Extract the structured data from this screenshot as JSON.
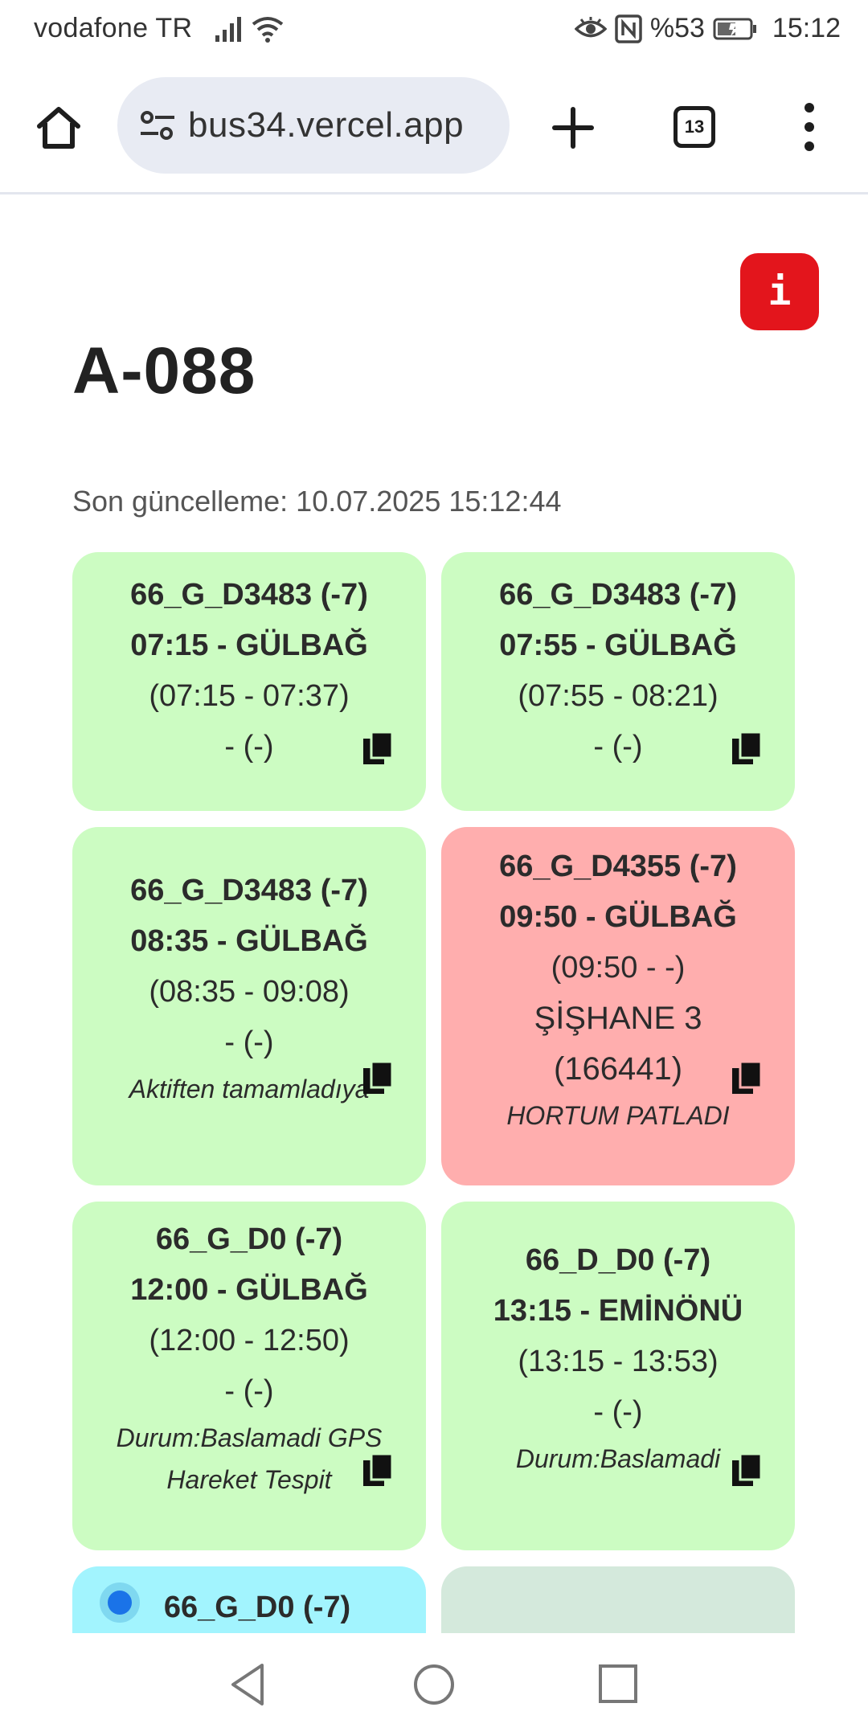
{
  "status_bar": {
    "carrier": "vodafone TR",
    "battery": "%53",
    "time": "15:12"
  },
  "browser": {
    "url": "bus34.vercel.app",
    "tab_count": "13"
  },
  "page": {
    "info_label": "i",
    "title": "A-088",
    "last_update": "Son güncelleme: 10.07.2025 15:12:44"
  },
  "cards": [
    {
      "status": "green",
      "code": "66_G_D3483 (-7)",
      "departure": "07:15 - GÜLBAĞ",
      "times": "(07:15 - 07:37)",
      "info": "- (-)"
    },
    {
      "status": "green",
      "code": "66_G_D3483 (-7)",
      "departure": "07:55 - GÜLBAĞ",
      "times": "(07:55 - 08:21)",
      "info": "- (-)"
    },
    {
      "status": "green",
      "code": "66_G_D3483 (-7)",
      "departure": "08:35 - GÜLBAĞ",
      "times": "(08:35 - 09:08)",
      "info": "- (-)",
      "note": "Aktiften tamamladıya"
    },
    {
      "status": "red",
      "code": "66_G_D4355 (-7)",
      "departure": "09:50 - GÜLBAĞ",
      "times": "(09:50 - -)",
      "driver": "ŞİŞHANE 3",
      "driver_id": "(166441)",
      "note": "HORTUM PATLADI"
    },
    {
      "status": "green",
      "code": "66_G_D0 (-7)",
      "departure": "12:00 - GÜLBAĞ",
      "times": "(12:00 - 12:50)",
      "info": "- (-)",
      "note_line1": "Durum:Baslamadi GPS",
      "note_line2": "Hareket Tespit"
    },
    {
      "status": "green",
      "code": "66_D_D0 (-7)",
      "departure": "13:15 - EMİNÖNÜ",
      "times": "(13:15 - 13:53)",
      "info": "- (-)",
      "note": "Durum:Baslamadi"
    },
    {
      "status": "cyan",
      "code": "66_G_D0 (-7)"
    },
    {
      "status": "grey"
    }
  ],
  "colors": {
    "card_green": "#ccfcc2",
    "card_red": "#ffaeae",
    "card_cyan": "#a2f4fe",
    "card_grey": "#d4e9dc",
    "info_red": "#e3151c"
  }
}
